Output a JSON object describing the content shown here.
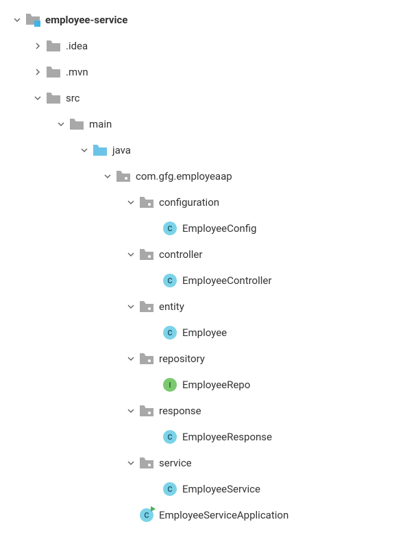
{
  "tree": {
    "root": "employee-service",
    "idea": ".idea",
    "mvn": ".mvn",
    "src": "src",
    "main": "main",
    "java": "java",
    "package": "com.gfg.employeaap",
    "configuration": "configuration",
    "employeeConfig": "EmployeeConfig",
    "controller": "controller",
    "employeeController": "EmployeeController",
    "entity": "entity",
    "employee": "Employee",
    "repository": "repository",
    "employeeRepo": "EmployeeRepo",
    "response": "response",
    "employeeResponse": "EmployeeResponse",
    "service": "service",
    "employeeService": "EmployeeService",
    "employeeServiceApplication": "EmployeeServiceApplication"
  }
}
